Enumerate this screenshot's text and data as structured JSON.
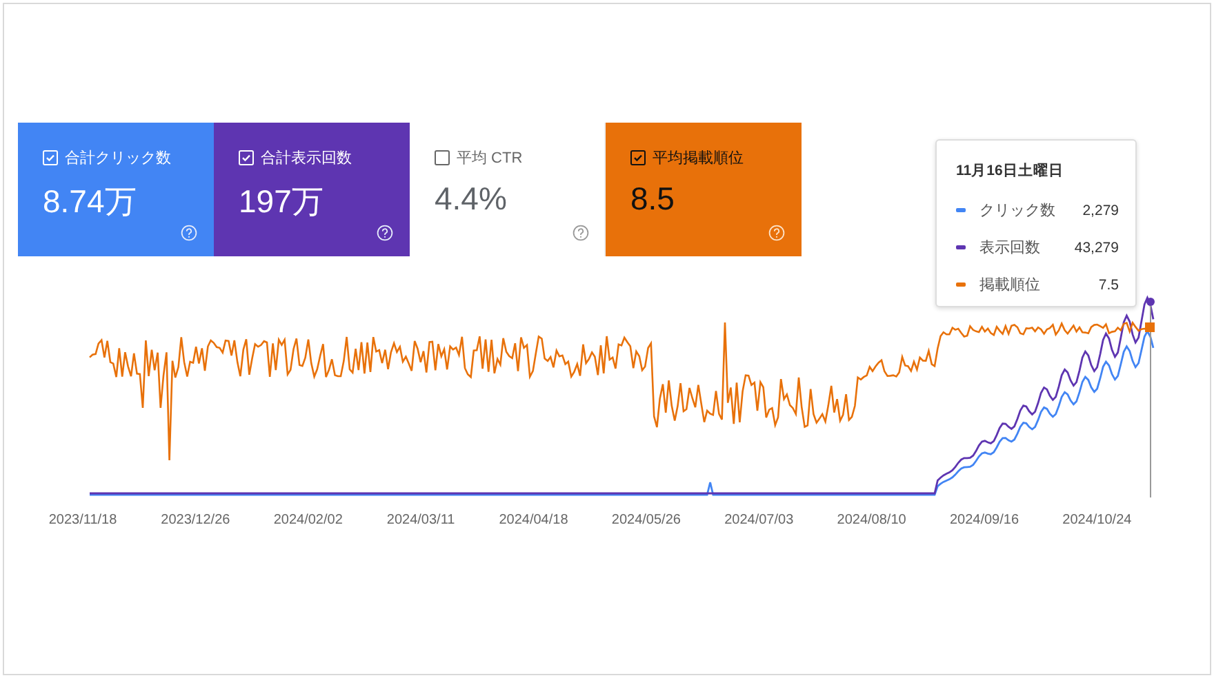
{
  "metrics": [
    {
      "label": "合計クリック数",
      "value": "8.74万",
      "checked": true,
      "color": "#4285f4"
    },
    {
      "label": "合計表示回数",
      "value": "197万",
      "checked": true,
      "color": "#5e35b1"
    },
    {
      "label": "平均 CTR",
      "value": "4.4%",
      "checked": false
    },
    {
      "label": "平均掲載順位",
      "value": "8.5",
      "checked": true,
      "color": "#e8710a"
    }
  ],
  "tooltip": {
    "date": "11月16日土曜日",
    "items": [
      {
        "name": "クリック数",
        "value": "2,279",
        "color": "#4285f4"
      },
      {
        "name": "表示回数",
        "value": "43,279",
        "color": "#5e35b1"
      },
      {
        "name": "掲載順位",
        "value": "7.5",
        "color": "#e8710a"
      }
    ]
  },
  "x_labels": [
    "2023/11/18",
    "2023/12/26",
    "2024/02/02",
    "2024/03/11",
    "2024/04/18",
    "2024/05/26",
    "2024/07/03",
    "2024/08/10",
    "2024/09/16",
    "2024/10/24"
  ]
}
